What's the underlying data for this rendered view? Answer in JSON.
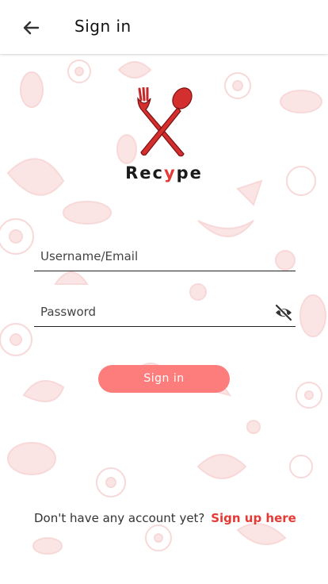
{
  "header": {
    "title": "Sign in",
    "back_icon": "arrow-left-icon"
  },
  "logo": {
    "prefix": "Rec",
    "highlight": "y",
    "suffix": "pe",
    "icon": "crossed-fork-spoon-icon",
    "accent_color": "#e53935"
  },
  "form": {
    "username_placeholder": "Username/Email",
    "password_placeholder": "Password",
    "password_toggle_icon": "eye-off-icon",
    "submit_label": "Sign in",
    "submit_color": "#fd7c7c"
  },
  "footer": {
    "prompt": "Don't have any account yet?",
    "link": "Sign up here"
  },
  "background": {
    "pattern": "food-doodle-pattern",
    "pattern_color": "#fbe3e3"
  }
}
